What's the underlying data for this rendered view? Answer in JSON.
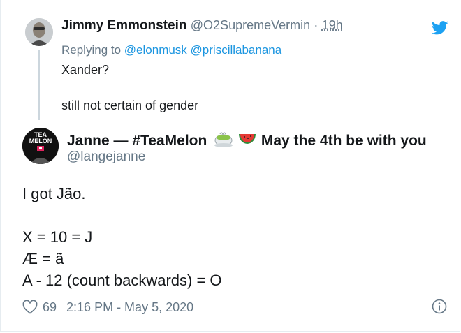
{
  "parent_tweet": {
    "name": "Jimmy Emmonstein",
    "handle": "@O2SupremeVermin",
    "separator": "·",
    "time": "19h",
    "replying_prefix": "Replying to",
    "replying_to": [
      "@elonmusk",
      "@priscillabanana"
    ],
    "text_line_1": "Xander?",
    "text_line_2": "still not certain of gender"
  },
  "main_tweet": {
    "name": "Janne — #TeaMelon",
    "name_suffix": "May the 4th be with you",
    "handle": "@langejanne",
    "avatar_text_1": "TEA",
    "avatar_text_2": "MELON",
    "body_lines": [
      "I got Jão.",
      "",
      "X = 10 = J",
      "Æ = ã",
      "A - 12 (count backwards) = O"
    ],
    "likes": "69",
    "timestamp": "2:16 PM - May 5, 2020"
  },
  "colors": {
    "twitter_blue": "#1da1f2",
    "link_blue": "#1b95e0",
    "secondary_text": "#657786",
    "primary_text": "#14171a",
    "thread_line": "#ccd6dd"
  },
  "icons": [
    "twitter-bird-icon",
    "matcha-tea-emoji-icon",
    "watermelon-emoji-icon",
    "heart-icon",
    "info-icon"
  ]
}
